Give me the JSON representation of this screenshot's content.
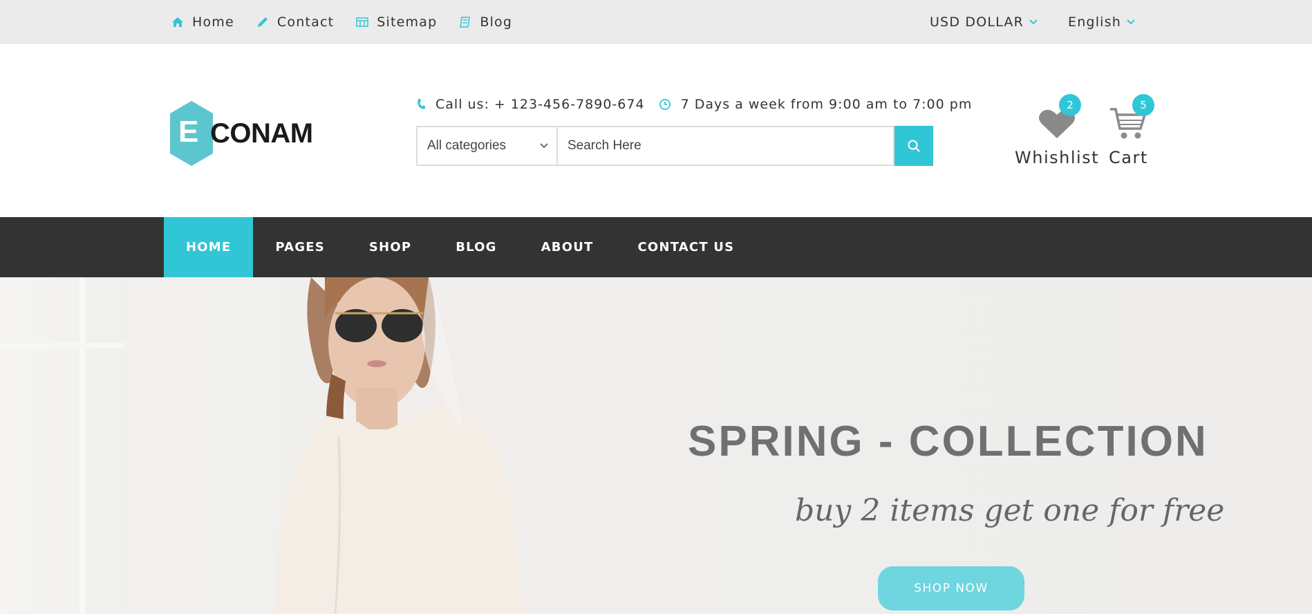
{
  "topbar": {
    "links": [
      {
        "label": "Home",
        "icon": "home-icon"
      },
      {
        "label": "Contact",
        "icon": "pencil-icon"
      },
      {
        "label": "Sitemap",
        "icon": "sitemap-icon"
      },
      {
        "label": "Blog",
        "icon": "blog-icon"
      }
    ],
    "currency": "USD DOLLAR",
    "language": "English"
  },
  "logo": {
    "letter": "E",
    "text": "CONAM"
  },
  "contact": {
    "phone": "Call us: + 123-456-7890-674",
    "hours": "7 Days a week from 9:00 am to 7:00 pm"
  },
  "search": {
    "category": "All categories",
    "placeholder": "Search Here"
  },
  "header_icons": {
    "wishlist_label": "Whishlist",
    "wishlist_count": "2",
    "cart_label": "Cart",
    "cart_count": "5"
  },
  "nav": {
    "items": [
      "HOME",
      "PAGES",
      "SHOP",
      "BLOG",
      "ABOUT",
      "CONTACT US"
    ]
  },
  "hero": {
    "title": "SPRING - COLLECTION",
    "subtitle": "buy 2 items get one for free",
    "button": "SHOP NOW"
  },
  "colors": {
    "accent": "#31c6d6",
    "nav_bg": "#333333",
    "topbar_bg": "#ebebeb"
  }
}
